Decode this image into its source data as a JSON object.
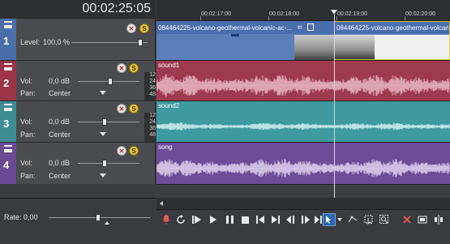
{
  "time_display": "00:02:25:05",
  "ruler": {
    "labels": [
      "00:02:17:00",
      "00:02:18:00",
      "00:02:19:00",
      "00:02:20:00"
    ]
  },
  "meter_scale": [
    "12",
    "24",
    "36",
    "48"
  ],
  "tracks": [
    {
      "number": "1",
      "type": "video",
      "level_label": "Level:",
      "level_value": "100,0 %",
      "color": "#4a6fa8",
      "events": [
        "084464225-volcano-geothermal-volcanic-ac-...",
        "084464225-volcano-geothermal-volcanic-ac..."
      ]
    },
    {
      "number": "2",
      "type": "audio",
      "vol_label": "Vol:",
      "vol_value": "0,0 dB",
      "pan_label": "Pan:",
      "pan_value": "Center",
      "color": "#9a3446",
      "clip": "sound1",
      "lane_color": "#9e3a4e",
      "wave_color": "#e7b7c1"
    },
    {
      "number": "3",
      "type": "audio",
      "vol_label": "Vol:",
      "vol_value": "0,0 dB",
      "pan_label": "Pan:",
      "pan_value": "Center",
      "color": "#3d8d93",
      "clip": "sound2",
      "lane_color": "#3f9aa0",
      "wave_color": "#cdeef0"
    },
    {
      "number": "4",
      "type": "audio",
      "vol_label": "Vol:",
      "vol_value": "0,0 dB",
      "pan_label": "Pan:",
      "pan_value": "Center",
      "color": "#6a4a92",
      "clip": "song",
      "lane_color": "#6d4c98",
      "wave_color": "#e0d0ee"
    }
  ],
  "rate": {
    "label": "Rate: 0,00"
  },
  "transport_icons": [
    "record-icon",
    "loop-icon",
    "play-from-start-icon",
    "play-icon",
    "pause-icon",
    "stop-icon",
    "go-to-start-icon",
    "go-to-end-icon",
    "previous-frame-icon",
    "next-frame-icon",
    "last-frame-icon",
    "normal-edit-tool-icon",
    "edit-tool-dropdown-icon",
    "envelope-tool-icon",
    "selection-tool-icon",
    "zoom-tool-icon",
    "delete-icon",
    "trim-icon",
    "split-icon"
  ]
}
